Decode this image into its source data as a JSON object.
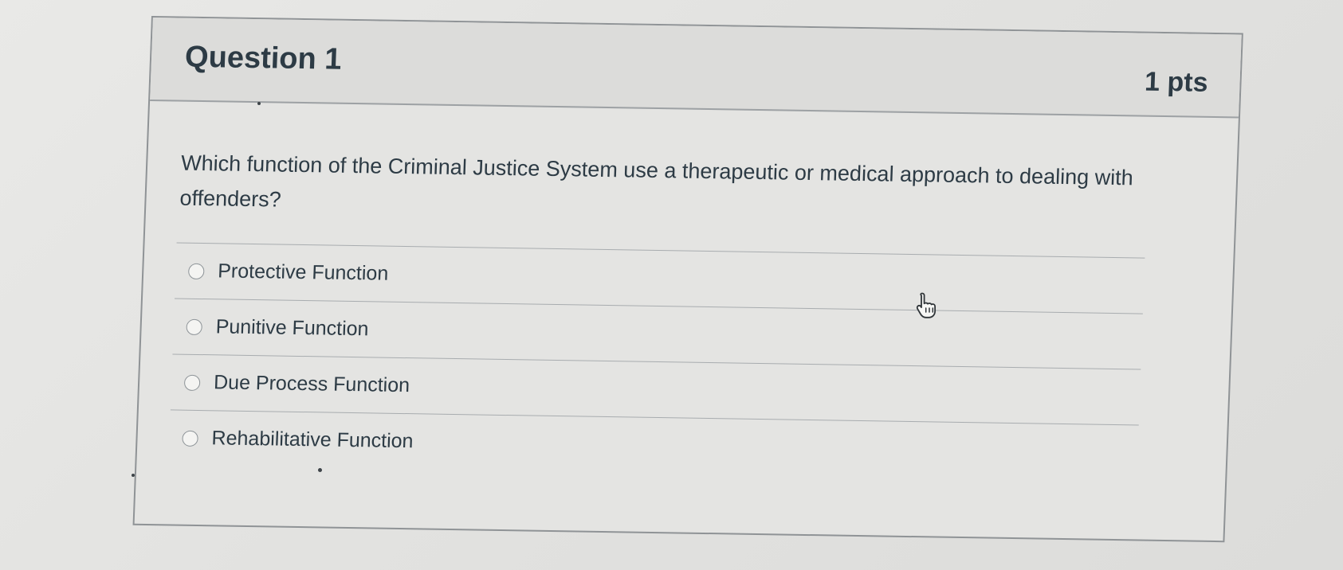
{
  "question": {
    "title": "Question 1",
    "points": "1 pts",
    "prompt": "Which function of the Criminal Justice System use a therapeutic or medical approach to dealing with offenders?"
  },
  "answers": [
    {
      "label": "Protective Function",
      "selected": false
    },
    {
      "label": "Punitive Function",
      "selected": false
    },
    {
      "label": "Due Process Function",
      "selected": false
    },
    {
      "label": "Rehabilitative Function",
      "selected": false
    }
  ],
  "colors": {
    "text": "#2d3b45",
    "border": "#8f9396",
    "header_background": "#dcdcda",
    "card_background": "#e4e4e2"
  },
  "icons": {
    "cursor": "hand-pointer-icon",
    "answer_control": "radio-button-icon"
  }
}
